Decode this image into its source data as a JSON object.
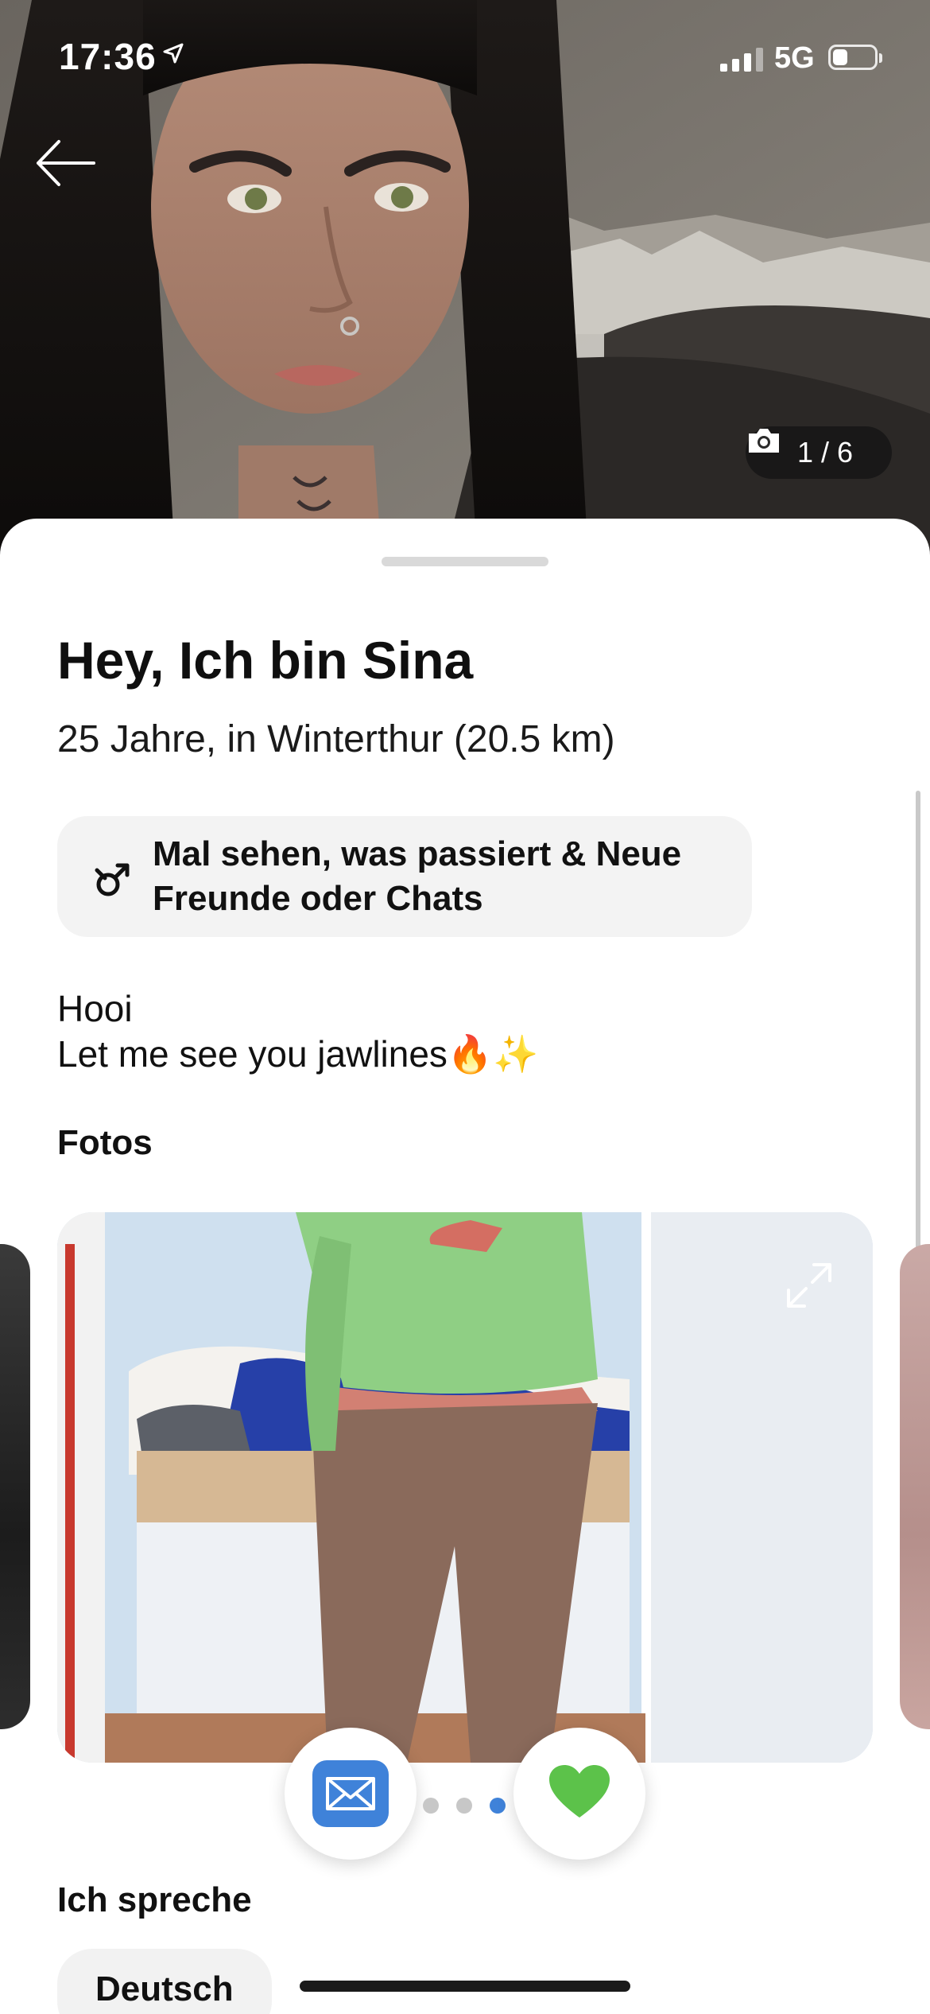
{
  "status_bar": {
    "time": "17:36",
    "network": "5G",
    "battery_level": 0.35
  },
  "hero": {
    "photo_counter": "1 / 6",
    "icons": {
      "back": "arrow-left-icon",
      "camera": "camera-icon"
    }
  },
  "profile": {
    "title": "Hey, Ich bin Sina",
    "subtitle": "25 Jahre, in Winterthur (20.5 km)",
    "intent": "Mal sehen, was passiert & Neue Freunde oder Chats",
    "bio": "Hooi\nLet me see you jawlines🔥✨"
  },
  "photos_section": {
    "title": "Fotos",
    "carousel": {
      "page_count": 3,
      "active_index": 2
    }
  },
  "actions": {
    "message_icon": "envelope-icon",
    "like_icon": "heart-icon"
  },
  "languages_section": {
    "title": "Ich spreche",
    "items": [
      "Deutsch"
    ]
  },
  "colors": {
    "accent_blue": "#3f82d9",
    "like_green": "#5cc24a",
    "chip_background": "#f3f3f3"
  }
}
